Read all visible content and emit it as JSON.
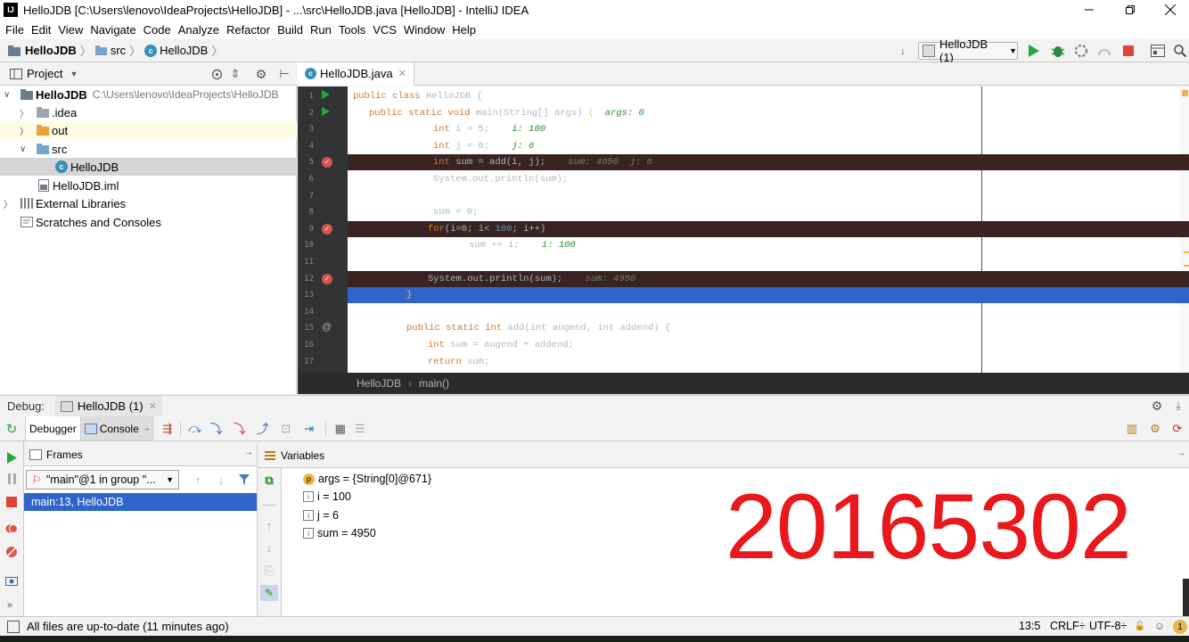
{
  "window": {
    "title": "HelloJDB [C:\\Users\\lenovo\\IdeaProjects\\HelloJDB] - ...\\src\\HelloJDB.java [HelloJDB] - IntelliJ IDEA"
  },
  "menu": [
    "File",
    "Edit",
    "View",
    "Navigate",
    "Code",
    "Analyze",
    "Refactor",
    "Build",
    "Run",
    "Tools",
    "VCS",
    "Window",
    "Help"
  ],
  "nav": {
    "project": "HelloJDB",
    "src": "src",
    "file": "HelloJDB",
    "run_config": "HelloJDB (1)"
  },
  "project_panel": {
    "title": "Project",
    "root": {
      "name": "HelloJDB",
      "path": "C:\\Users\\lenovo\\IdeaProjects\\HelloJDB"
    },
    "items": [
      ".idea",
      "out",
      "src",
      "HelloJDB",
      "HelloJDB.iml",
      "External Libraries",
      "Scratches and Consoles"
    ]
  },
  "editor": {
    "tab": "HelloJDB.java",
    "breadcrumb": [
      "HelloJDB",
      "main()"
    ],
    "lines": [
      {
        "n": "1",
        "parts": [
          [
            "kw",
            "public class "
          ],
          [
            "dim",
            "HelloJDB {"
          ]
        ]
      },
      {
        "n": "2",
        "parts": [
          [
            "kw",
            "public static void "
          ],
          [
            "dim",
            "main(String[] args) "
          ],
          [
            "fn",
            "{"
          ],
          [
            "inlw",
            "  args: "
          ],
          [
            "inlw",
            "0"
          ]
        ]
      },
      {
        "n": "3",
        "parts": [
          [
            "kw",
            "int "
          ],
          [
            "dim",
            "i = 5;  "
          ],
          [
            "inlw",
            "  i: 100"
          ]
        ]
      },
      {
        "n": "4",
        "parts": [
          [
            "kw",
            "int "
          ],
          [
            "dim",
            "j = 6;  "
          ],
          [
            "inlw",
            "  j: 6"
          ]
        ]
      },
      {
        "n": "5",
        "parts": [
          [
            "kw",
            "int "
          ],
          [
            "pl",
            "sum = "
          ],
          [
            "pl",
            "add(i, j);  "
          ],
          [
            "inl",
            "  sum: 4950  j: 6"
          ]
        ]
      },
      {
        "n": "6",
        "parts": [
          [
            "dim",
            "System.out.println(sum);"
          ]
        ]
      },
      {
        "n": "7",
        "parts": []
      },
      {
        "n": "8",
        "parts": [
          [
            "dim",
            "sum = 0;"
          ]
        ]
      },
      {
        "n": "9",
        "parts": [
          [
            "kw",
            "for"
          ],
          [
            "pl",
            "(i=0; i< "
          ],
          [
            "num",
            "100"
          ],
          [
            "pl",
            "; i++)"
          ]
        ]
      },
      {
        "n": "10",
        "parts": [
          [
            "dim",
            "sum += i;  "
          ],
          [
            "inlw",
            "  i: 100"
          ]
        ]
      },
      {
        "n": "11",
        "parts": []
      },
      {
        "n": "12",
        "parts": [
          [
            "pl",
            "System.out.println(sum);  "
          ],
          [
            "inl",
            "  sum: 4950"
          ]
        ]
      },
      {
        "n": "13",
        "parts": [
          [
            "fn",
            "}"
          ]
        ]
      },
      {
        "n": "14",
        "parts": []
      },
      {
        "n": "15",
        "parts": [
          [
            "kw",
            "public static int "
          ],
          [
            "dim",
            "add(int augend, int addend) {"
          ]
        ]
      },
      {
        "n": "16",
        "parts": [
          [
            "kw",
            "int "
          ],
          [
            "dim",
            "sum = augend + addend;"
          ]
        ]
      },
      {
        "n": "17",
        "parts": [
          [
            "kw",
            "return "
          ],
          [
            "dim",
            "sum;"
          ]
        ]
      }
    ]
  },
  "debug": {
    "label": "Debug:",
    "session": "HelloJDB (1)",
    "debugger_tab": "Debugger",
    "console_tab": "Console",
    "frames_title": "Frames",
    "thread": "\"main\"@1 in group \"...",
    "frame": "main:13, HelloJDB",
    "variables_title": "Variables",
    "variables": [
      {
        "badge": "p",
        "text": "args = {String[0]@671}"
      },
      {
        "badge": "i",
        "text": "i = 100"
      },
      {
        "badge": "i",
        "text": "j = 6"
      },
      {
        "badge": "i",
        "text": "sum = 4950"
      }
    ],
    "watermark": "20165302"
  },
  "status": {
    "message": "All files are up-to-date (11 minutes ago)",
    "position": "13:5",
    "line_sep": "CRLF÷",
    "encoding": "UTF-8÷"
  },
  "colors": {
    "accent": "#2f65ca",
    "breakpoint": "#d9534f",
    "run": "#22a83c",
    "watermark": "#e8181c"
  }
}
